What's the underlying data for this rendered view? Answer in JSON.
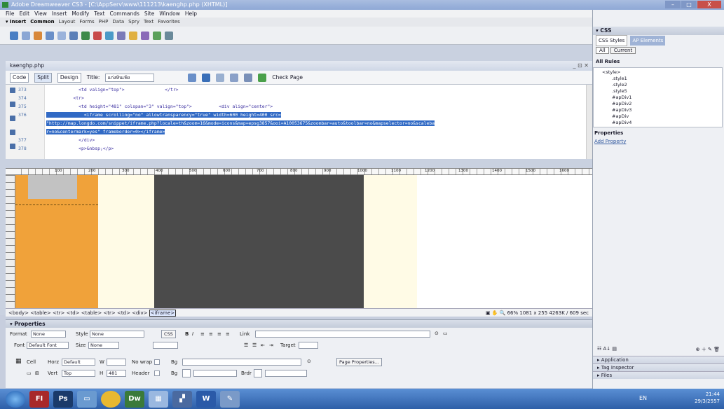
{
  "window": {
    "title": "Adobe Dreamweaver CS3 - [C:\\AppServ\\www\\111213\\kaenghp.php (XHTML)]",
    "min": "–",
    "max": "□",
    "close": "X"
  },
  "menu": [
    "File",
    "Edit",
    "View",
    "Insert",
    "Modify",
    "Text",
    "Commands",
    "Site",
    "Window",
    "Help"
  ],
  "insert_bar": [
    "▾ Insert",
    "Common",
    "Layout",
    "Forms",
    "PHP",
    "Data",
    "Spry",
    "Text",
    "Favorites"
  ],
  "document": {
    "tab": "kaenghp.php",
    "controls": "_ ⊡ ✕",
    "view_buttons": {
      "code": "Code",
      "split": "Split",
      "design": "Design"
    },
    "title_label": "Title:",
    "title_value": "แก่งหินเพิง",
    "check_page": "Check Page",
    "code_lines": [
      {
        "num": "373",
        "text": "            <td valign=\"top\">               </tr>"
      },
      {
        "num": "374",
        "text": "          <tr>"
      },
      {
        "num": "375",
        "text": "            <td height=\"481\" colspan=\"3\" valign=\"top\">          <div align=\"center\">"
      },
      {
        "num": "376",
        "text": "              <iframe scrolling=\"no\" allowtransparency=\"true\" width=600 height=400 src="
      },
      {
        "num": "",
        "text": "\"http://map.longdo.com/snippet/iframe.php?locale=th&zoom=16&mode=icons&map=epsg3857&ooi=A10053675&zoombar=auto&toolbar=no&mapselector=no&scaleba"
      },
      {
        "num": "",
        "text": "r=no&centermark=yes\" frameborder=0></iframe>"
      },
      {
        "num": "377",
        "text": "            </div>"
      },
      {
        "num": "378",
        "text": "            <p>&nbsp;</p>"
      }
    ],
    "ruler_labels": [
      "100",
      "200",
      "300",
      "400",
      "500",
      "600",
      "700",
      "800",
      "900",
      "1000",
      "1100",
      "1200",
      "1300",
      "1400",
      "1500",
      "1600"
    ]
  },
  "status": {
    "tags": [
      "<body>",
      "<table>",
      "<tr>",
      "<td>",
      "<table>",
      "<tr>",
      "<td>",
      "<div>"
    ],
    "selected_tag": "<iframe>",
    "zoom": "66%",
    "size": "1081 x 255",
    "weight": "4263K / 609 sec"
  },
  "properties": {
    "header": "▾ Properties",
    "format_label": "Format",
    "format_value": "None",
    "style_label": "Style",
    "style_value": "None",
    "css_button": "CSS",
    "bold": "B",
    "italic": "I",
    "link_label": "Link",
    "font_label": "Font",
    "font_value": "Default Font",
    "size_label": "Size",
    "size_value": "None",
    "target_label": "Target",
    "cell_label": "Cell",
    "horz_label": "Horz",
    "horz_value": "Default",
    "w_label": "W",
    "nowrap_label": "No wrap",
    "bg_label": "Bg",
    "vert_label": "Vert",
    "vert_value": "Top",
    "h_label": "H",
    "h_value": "481",
    "header_label": "Header",
    "brdr_label": "Brdr",
    "page_props_button": "Page Properties..."
  },
  "right_panel": {
    "css_header": "▾ CSS",
    "tab_styles": "CSS Styles",
    "tab_ap": "AP Elements",
    "btn_all": "All",
    "btn_current": "Current",
    "all_rules": "All Rules",
    "rules": [
      "<style>",
      ".style1",
      ".style2",
      ".style5",
      "#apDiv1",
      "#apDiv2",
      "#apDiv3",
      "#apDiv",
      "#apDiv4"
    ],
    "properties_label": "Properties",
    "add_property": "Add Property",
    "application": "▸ Application",
    "tag_inspector": "▸ Tag Inspector",
    "files": "▸ Files"
  },
  "taskbar": {
    "items": [
      "FI",
      "Ps",
      "Dw",
      "W"
    ],
    "lang": "EN",
    "time": "21:44",
    "date": "29/3/2557"
  },
  "colors": {
    "accent": "#316ac5",
    "orange_block": "#f0a23a",
    "map_block": "#4b4b4b"
  }
}
